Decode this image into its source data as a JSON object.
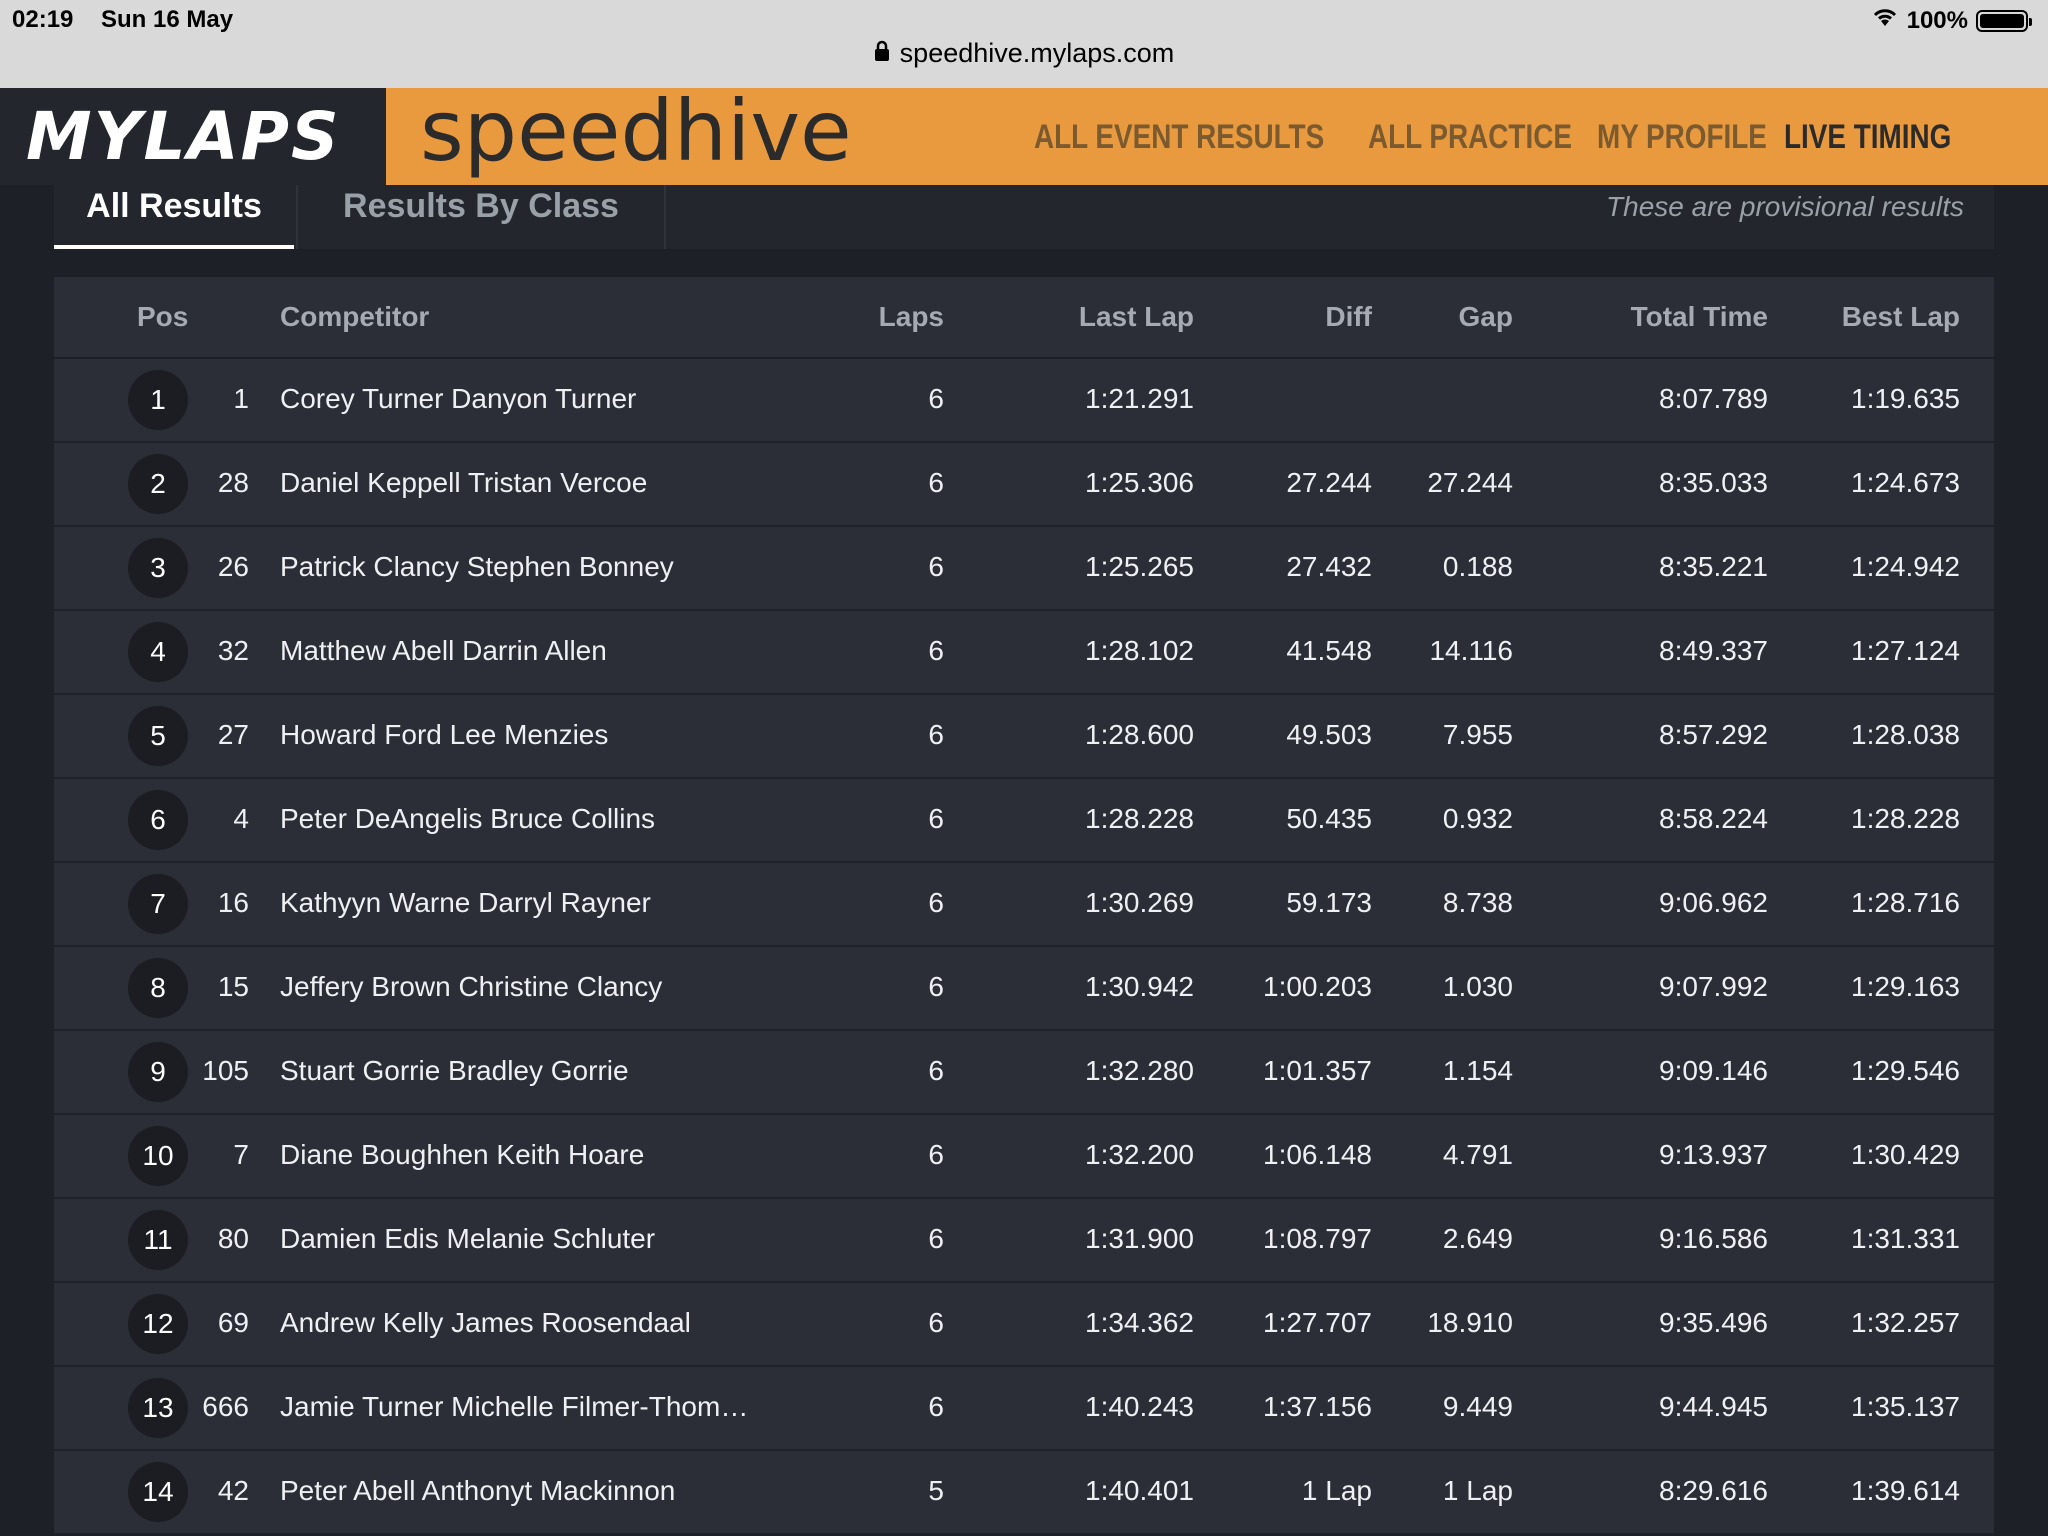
{
  "status_bar": {
    "time": "02:19",
    "date": "Sun 16 May",
    "battery": "100%"
  },
  "url": "speedhive.mylaps.com",
  "header": {
    "logo": "MYLAPS",
    "brand": "speedhive",
    "nav": [
      "ALL EVENT RESULTS",
      "ALL PRACTICE",
      "MY PROFILE",
      "LIVE TIMING"
    ]
  },
  "tabs": {
    "all": "All Results",
    "by_class": "Results By Class",
    "notice": "These are provisional results"
  },
  "columns": {
    "pos": "Pos",
    "competitor": "Competitor",
    "laps": "Laps",
    "last_lap": "Last Lap",
    "diff": "Diff",
    "gap": "Gap",
    "total_time": "Total Time",
    "best_lap": "Best Lap"
  },
  "rows": [
    {
      "pos": "1",
      "num": "1",
      "competitor": "Corey Turner Danyon Turner",
      "laps": "6",
      "last_lap": "1:21.291",
      "diff": "",
      "gap": "",
      "total": "8:07.789",
      "best": "1:19.635"
    },
    {
      "pos": "2",
      "num": "28",
      "competitor": "Daniel Keppell Tristan Vercoe",
      "laps": "6",
      "last_lap": "1:25.306",
      "diff": "27.244",
      "gap": "27.244",
      "total": "8:35.033",
      "best": "1:24.673"
    },
    {
      "pos": "3",
      "num": "26",
      "competitor": "Patrick Clancy Stephen Bonney",
      "laps": "6",
      "last_lap": "1:25.265",
      "diff": "27.432",
      "gap": "0.188",
      "total": "8:35.221",
      "best": "1:24.942"
    },
    {
      "pos": "4",
      "num": "32",
      "competitor": "Matthew Abell Darrin Allen",
      "laps": "6",
      "last_lap": "1:28.102",
      "diff": "41.548",
      "gap": "14.116",
      "total": "8:49.337",
      "best": "1:27.124"
    },
    {
      "pos": "5",
      "num": "27",
      "competitor": "Howard Ford Lee Menzies",
      "laps": "6",
      "last_lap": "1:28.600",
      "diff": "49.503",
      "gap": "7.955",
      "total": "8:57.292",
      "best": "1:28.038"
    },
    {
      "pos": "6",
      "num": "4",
      "competitor": "Peter DeAngelis Bruce Collins",
      "laps": "6",
      "last_lap": "1:28.228",
      "diff": "50.435",
      "gap": "0.932",
      "total": "8:58.224",
      "best": "1:28.228"
    },
    {
      "pos": "7",
      "num": "16",
      "competitor": "Kathyyn Warne Darryl Rayner",
      "laps": "6",
      "last_lap": "1:30.269",
      "diff": "59.173",
      "gap": "8.738",
      "total": "9:06.962",
      "best": "1:28.716"
    },
    {
      "pos": "8",
      "num": "15",
      "competitor": "Jeffery Brown Christine Clancy",
      "laps": "6",
      "last_lap": "1:30.942",
      "diff": "1:00.203",
      "gap": "1.030",
      "total": "9:07.992",
      "best": "1:29.163"
    },
    {
      "pos": "9",
      "num": "105",
      "competitor": "Stuart Gorrie Bradley Gorrie",
      "laps": "6",
      "last_lap": "1:32.280",
      "diff": "1:01.357",
      "gap": "1.154",
      "total": "9:09.146",
      "best": "1:29.546"
    },
    {
      "pos": "10",
      "num": "7",
      "competitor": "Diane Boughhen Keith Hoare",
      "laps": "6",
      "last_lap": "1:32.200",
      "diff": "1:06.148",
      "gap": "4.791",
      "total": "9:13.937",
      "best": "1:30.429"
    },
    {
      "pos": "11",
      "num": "80",
      "competitor": "Damien Edis Melanie Schluter",
      "laps": "6",
      "last_lap": "1:31.900",
      "diff": "1:08.797",
      "gap": "2.649",
      "total": "9:16.586",
      "best": "1:31.331"
    },
    {
      "pos": "12",
      "num": "69",
      "competitor": "Andrew Kelly James Roosendaal",
      "laps": "6",
      "last_lap": "1:34.362",
      "diff": "1:27.707",
      "gap": "18.910",
      "total": "9:35.496",
      "best": "1:32.257"
    },
    {
      "pos": "13",
      "num": "666",
      "competitor": "Jamie Turner Michelle Filmer-Thom…",
      "laps": "6",
      "last_lap": "1:40.243",
      "diff": "1:37.156",
      "gap": "9.449",
      "total": "9:44.945",
      "best": "1:35.137"
    },
    {
      "pos": "14",
      "num": "42",
      "competitor": "Peter Abell Anthonyt Mackinnon",
      "laps": "5",
      "last_lap": "1:40.401",
      "diff": "1 Lap",
      "gap": "1 Lap",
      "total": "8:29.616",
      "best": "1:39.614"
    }
  ]
}
